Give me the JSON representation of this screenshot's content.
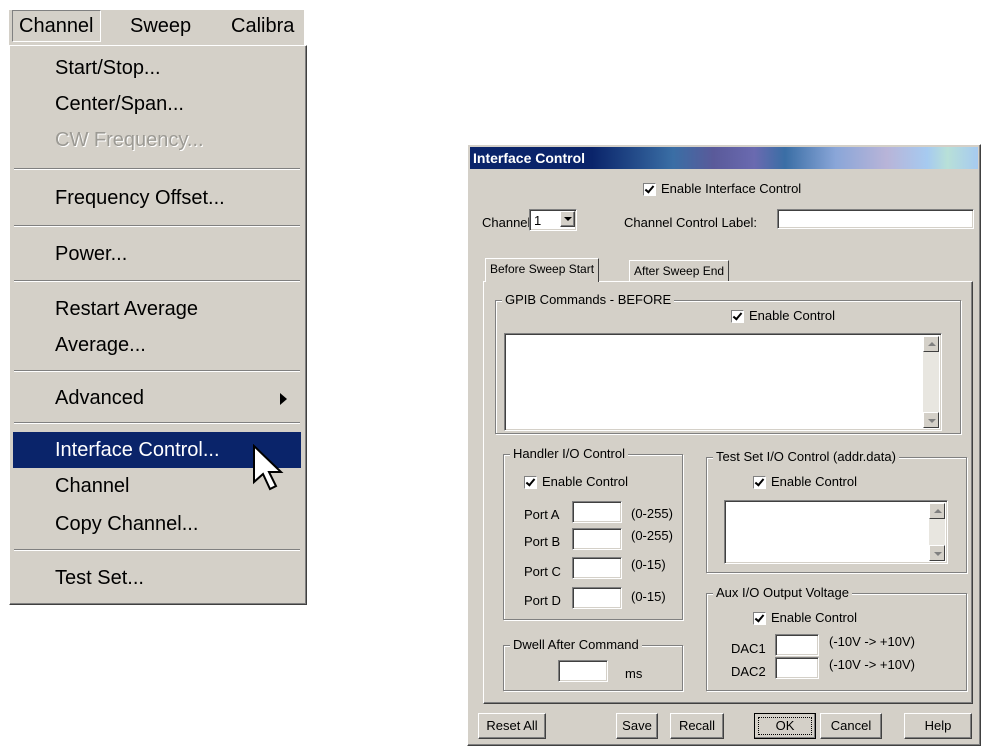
{
  "menubar": {
    "channel": "Channel",
    "sweep": "Sweep",
    "calibration": "Calibra"
  },
  "menu": {
    "start_stop": "Start/Stop...",
    "center_span": "Center/Span...",
    "cw_frequency": "CW Frequency...",
    "frequency_offset": "Frequency Offset...",
    "power": "Power...",
    "restart_average": "Restart Average",
    "average": "Average...",
    "advanced": "Advanced",
    "interface_control": "Interface Control...",
    "channel": "Channel",
    "copy_channel": "Copy Channel...",
    "test_set": "Test Set..."
  },
  "dialog": {
    "title": "Interface Control",
    "enable_interface_control": "Enable Interface Control",
    "channel_label": "Channel",
    "channel_value": "1",
    "channel_control_label": "Channel Control Label:",
    "channel_control_value": "",
    "tabs": [
      "Before Sweep Start",
      "After Sweep End"
    ],
    "gpib_title": "GPIB Commands - BEFORE",
    "enable_control": "Enable Control",
    "handler_title": "Handler I/O Control",
    "ports": [
      {
        "label": "Port A",
        "range": "(0-255)",
        "value": ""
      },
      {
        "label": "Port B",
        "range": "(0-255)",
        "value": ""
      },
      {
        "label": "Port C",
        "range": "(0-15)",
        "value": ""
      },
      {
        "label": "Port D",
        "range": "(0-15)",
        "value": ""
      }
    ],
    "testset_title": "Test Set I/O Control (addr.data)",
    "aux_title": "Aux I/O Output Voltage",
    "dacs": [
      {
        "label": "DAC1",
        "range": "(-10V -> +10V)",
        "value": ""
      },
      {
        "label": "DAC2",
        "range": "(-10V -> +10V)",
        "value": ""
      }
    ],
    "dwell_title": "Dwell After Command",
    "dwell_unit": "ms",
    "buttons": {
      "reset_all": "Reset All",
      "save": "Save",
      "recall": "Recall",
      "ok": "OK",
      "cancel": "Cancel",
      "help": "Help"
    }
  }
}
